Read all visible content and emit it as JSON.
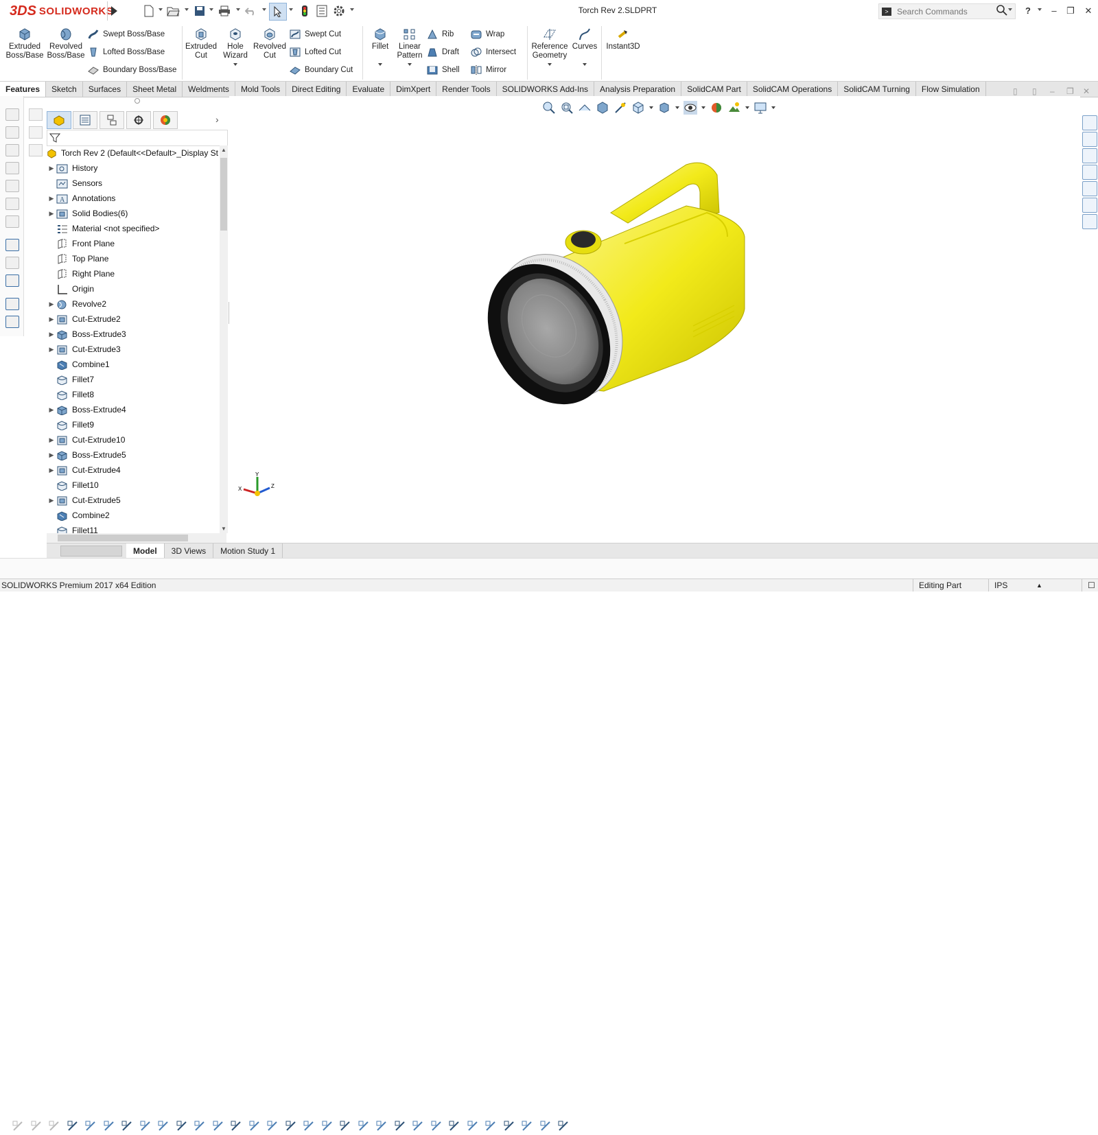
{
  "app": {
    "brand_mark": "3DS",
    "brand_name": "SOLIDWORKS",
    "document_title": "Torch Rev 2.SLDPRT"
  },
  "search": {
    "placeholder": "Search Commands"
  },
  "commands": {
    "extruded_boss": "Extruded Boss/Base",
    "revolved_boss": "Revolved Boss/Base",
    "swept_boss": "Swept Boss/Base",
    "lofted_boss": "Lofted Boss/Base",
    "boundary_boss": "Boundary Boss/Base",
    "extruded_cut": "Extruded Cut",
    "hole_wizard": "Hole Wizard",
    "revolved_cut": "Revolved Cut",
    "swept_cut": "Swept Cut",
    "lofted_cut": "Lofted Cut",
    "boundary_cut": "Boundary Cut",
    "fillet": "Fillet",
    "linear_pattern": "Linear Pattern",
    "rib": "Rib",
    "draft": "Draft",
    "shell": "Shell",
    "wrap": "Wrap",
    "intersect": "Intersect",
    "mirror": "Mirror",
    "reference_geometry": "Reference Geometry",
    "curves": "Curves",
    "instant3d": "Instant3D"
  },
  "tabs": [
    "Features",
    "Sketch",
    "Surfaces",
    "Sheet Metal",
    "Weldments",
    "Mold Tools",
    "Direct Editing",
    "Evaluate",
    "DimXpert",
    "Render Tools",
    "SOLIDWORKS Add-Ins",
    "Analysis Preparation",
    "SolidCAM Part",
    "SolidCAM Operations",
    "SolidCAM Turning",
    "Flow Simulation"
  ],
  "tree": {
    "root": "Torch Rev 2  (Default<<Default>_Display St",
    "items": [
      {
        "label": "History",
        "exp": "▶"
      },
      {
        "label": "Sensors",
        "exp": ""
      },
      {
        "label": "Annotations",
        "exp": "▶"
      },
      {
        "label": "Solid Bodies(6)",
        "exp": "▶"
      },
      {
        "label": "Material <not specified>",
        "exp": ""
      },
      {
        "label": "Front Plane",
        "exp": ""
      },
      {
        "label": "Top Plane",
        "exp": ""
      },
      {
        "label": "Right Plane",
        "exp": ""
      },
      {
        "label": "Origin",
        "exp": ""
      },
      {
        "label": "Revolve2",
        "exp": "▶"
      },
      {
        "label": "Cut-Extrude2",
        "exp": "▶"
      },
      {
        "label": "Boss-Extrude3",
        "exp": "▶"
      },
      {
        "label": "Cut-Extrude3",
        "exp": "▶"
      },
      {
        "label": "Combine1",
        "exp": ""
      },
      {
        "label": "Fillet7",
        "exp": ""
      },
      {
        "label": "Fillet8",
        "exp": ""
      },
      {
        "label": "Boss-Extrude4",
        "exp": "▶"
      },
      {
        "label": "Fillet9",
        "exp": ""
      },
      {
        "label": "Cut-Extrude10",
        "exp": "▶"
      },
      {
        "label": "Boss-Extrude5",
        "exp": "▶"
      },
      {
        "label": "Cut-Extrude4",
        "exp": "▶"
      },
      {
        "label": "Fillet10",
        "exp": ""
      },
      {
        "label": "Cut-Extrude5",
        "exp": "▶"
      },
      {
        "label": "Combine2",
        "exp": ""
      },
      {
        "label": "Fillet11",
        "exp": ""
      }
    ]
  },
  "bottom_tabs": [
    "Model",
    "3D Views",
    "Motion Study 1"
  ],
  "status": {
    "edition": "SOLIDWORKS Premium 2017 x64 Edition",
    "mode": "Editing Part",
    "units": "IPS"
  },
  "colors": {
    "body": "#f2ea1a",
    "accent": "#d52b1e",
    "lens_ring": "#111111"
  }
}
